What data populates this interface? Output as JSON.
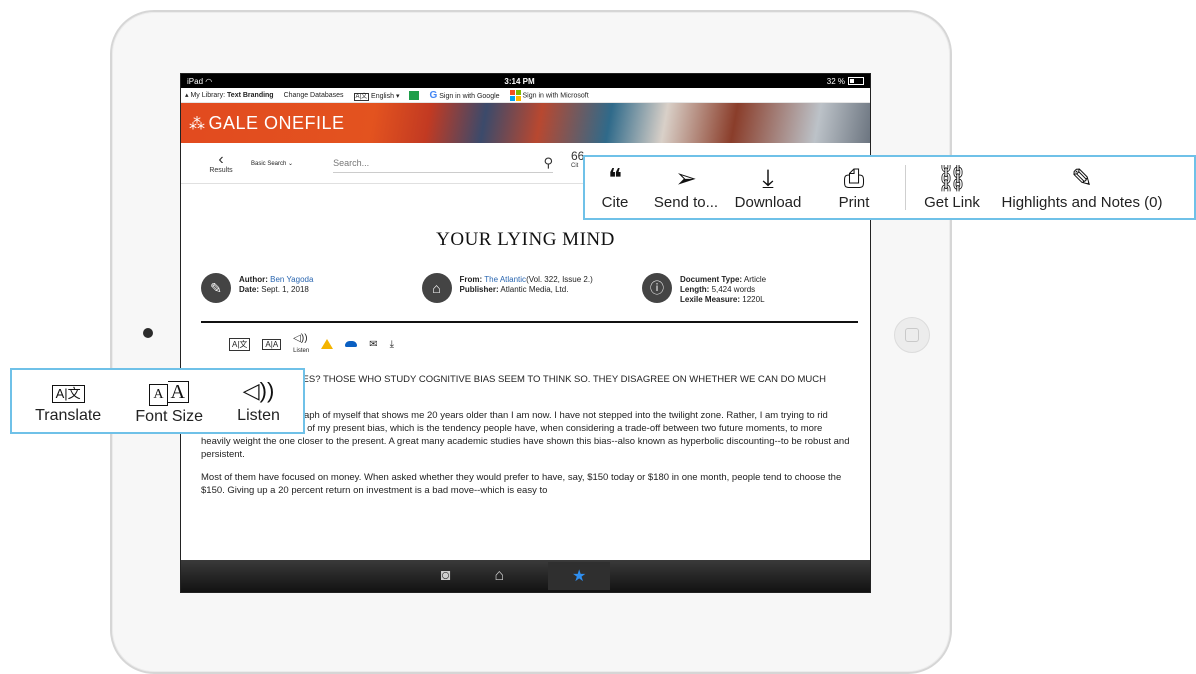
{
  "device": {
    "carrier": "iPad",
    "time": "3:14 PM",
    "battery": "32 %"
  },
  "library_bar": {
    "library_prefix": "My Library:",
    "library_name": "Text Branding",
    "change_db": "Change Databases",
    "language": "English",
    "google_signin": "Sign in with Google",
    "microsoft_signin": "Sign in with Microsoft"
  },
  "banner": {
    "logo_text": "GALE ONEFILE"
  },
  "search": {
    "back_label": "Results",
    "mode": "Basic Search",
    "placeholder": "Search...",
    "cite_peek": "Cit"
  },
  "article": {
    "title": "YOUR LYING MIND",
    "author_label": "Author:",
    "author": "Ben Yagoda",
    "date_label": "Date:",
    "date": "Sept. 1, 2018",
    "from_label": "From:",
    "from": "The Atlantic",
    "from_detail": "(Vol. 322, Issue 2.)",
    "publisher_label": "Publisher:",
    "publisher": "Atlantic Media, Ltd.",
    "doctype_label": "Document Type:",
    "doctype": "Article",
    "length_label": "Length:",
    "length": "5,424 words",
    "lexile_label": "Lexile Measure:",
    "lexile": "1220L",
    "listen_small": "Listen",
    "lead": "TO DELUDE OURSELVES? THOSE WHO STUDY COGNITIVE BIAS SEEM TO THINK SO. THEY DISAGREE ON WHETHER WE CAN DO MUCH ABOUT IT.",
    "p1": "I am staring at a photograph of myself that shows me 20 years older than I am now. I have not stepped into the twilight zone. Rather, I am trying to rid myself of some measure of my present bias, which is the tendency people have, when considering a trade-off between two future moments, to more heavily weight the one closer to the present. A great many academic studies have shown this bias--also known as hyperbolic discounting--to be robust and persistent.",
    "p2": "Most of them have focused on money. When asked whether they would prefer to have, say, $150 today or $180 in one month, people tend to choose the $150. Giving up a 20 percent return on investment is a bad move--which is easy to"
  },
  "callout_tools": {
    "cite": "Cite",
    "send": "Send to...",
    "download": "Download",
    "print": "Print",
    "get_link": "Get Link",
    "highlights": "Highlights and Notes (0)"
  },
  "callout_left": {
    "translate": "Translate",
    "font_size": "Font Size",
    "listen": "Listen"
  },
  "icons": {
    "cite": "quote-icon",
    "send": "paper-plane-icon",
    "download": "download-icon",
    "print": "printer-icon",
    "link": "link-icon",
    "highlight": "highlighter-icon"
  },
  "colors": {
    "callout_border": "#6fc1e8",
    "banner_orange": "#e24a1f",
    "link_blue": "#2a66b0"
  }
}
